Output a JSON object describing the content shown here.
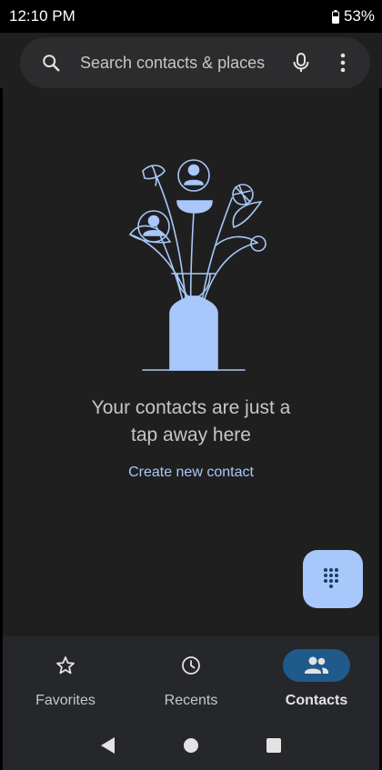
{
  "status": {
    "time": "12:10 PM",
    "battery": "53%"
  },
  "search": {
    "placeholder": "Search contacts & places",
    "icons": [
      "search-icon",
      "microphone-icon",
      "more-vert-icon"
    ]
  },
  "empty_state": {
    "message_line1": "Your contacts are just a",
    "message_line2": "tap away here",
    "create_label": "Create new contact"
  },
  "fab": {
    "icon": "dialpad-icon"
  },
  "bottom_nav": {
    "items": [
      {
        "label": "Favorites",
        "icon": "star-outline-icon",
        "active": false
      },
      {
        "label": "Recents",
        "icon": "clock-icon",
        "active": false
      },
      {
        "label": "Contacts",
        "icon": "people-icon",
        "active": true
      }
    ]
  },
  "system_nav": {
    "icons": [
      "back-icon",
      "home-icon",
      "overview-icon"
    ]
  },
  "colors": {
    "accent": "#a8c7fa",
    "active_pill": "#1f5a8a",
    "surface": "#1f1f1f",
    "nav_surface": "#26272b"
  }
}
